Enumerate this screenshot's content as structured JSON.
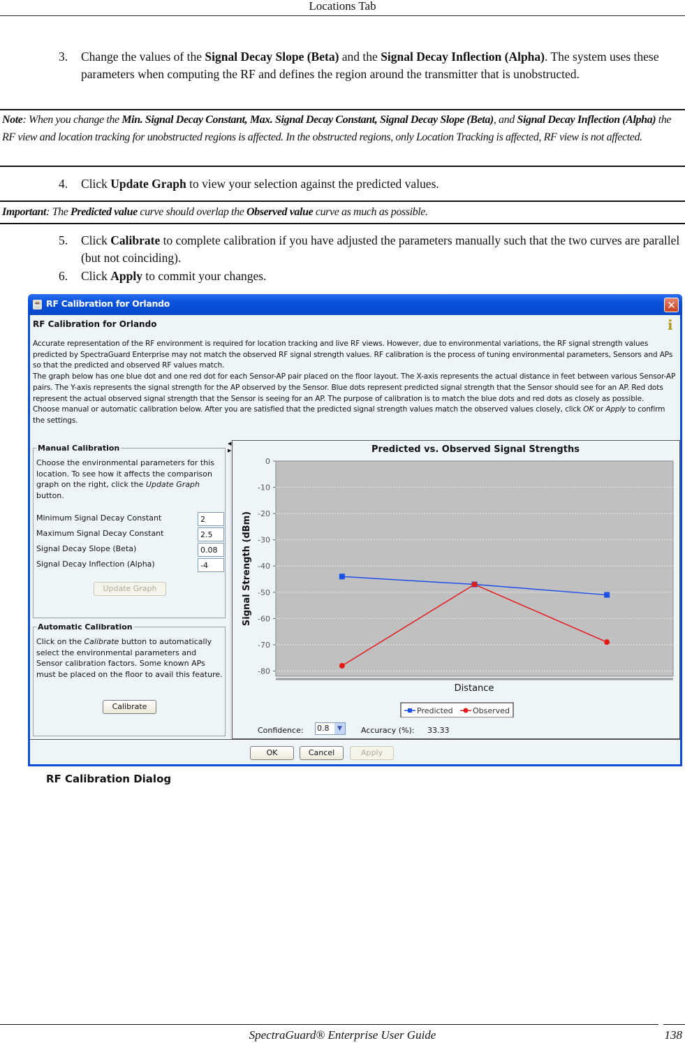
{
  "header": {
    "title": "Locations Tab"
  },
  "steps": [
    {
      "num": "3.",
      "parts": [
        {
          "t": "Change the values of the "
        },
        {
          "b": "Signal Decay Slope (Beta)"
        },
        {
          "t": " and the "
        },
        {
          "b": "Signal Decay Inflection (Alpha)"
        },
        {
          "t": ". The system uses these parameters when computing the RF and defines the region around the transmitter that is unobstructed."
        }
      ]
    },
    {
      "num": "4.",
      "parts": [
        {
          "t": "Click "
        },
        {
          "b": "Update Graph"
        },
        {
          "t": " to view your selection against the predicted values."
        }
      ]
    },
    {
      "num": "5.",
      "parts": [
        {
          "t": "Click "
        },
        {
          "b": "Calibrate"
        },
        {
          "t": " to complete calibration if you have adjusted the parameters manually such that the two curves are parallel (but not coinciding)."
        }
      ]
    },
    {
      "num": "6.",
      "parts": [
        {
          "t": "Click "
        },
        {
          "b": "Apply"
        },
        {
          "t": " to commit your changes."
        }
      ]
    }
  ],
  "note": {
    "parts": [
      {
        "b": "Note"
      },
      {
        "t": ": When you change the "
      },
      {
        "b": "Min. Signal Decay Constant, Max. Signal Decay Constant, Signal Decay Slope (Beta)"
      },
      {
        "t": ", and "
      },
      {
        "b": "Signal Decay Inflection (Alpha)"
      },
      {
        "t": " the RF view and location tracking for unobstructed regions is affected. In the obstructed regions, only Location Tracking is affected, RF view is not affected."
      }
    ]
  },
  "important": {
    "parts": [
      {
        "b": "Important"
      },
      {
        "t": ": The "
      },
      {
        "b": "Predicted value"
      },
      {
        "t": " curve should overlap the "
      },
      {
        "b": "Observed value"
      },
      {
        "t": " curve as much as possible."
      }
    ]
  },
  "dialog": {
    "window_title": "RF Calibration for Orlando",
    "heading": "RF Calibration for Orlando",
    "intro_paragraphs": [
      "Accurate representation of the RF environment is required for location tracking and live RF views. However, due to environmental variations, the RF signal strength values predicted by SpectraGuard Enterprise may not match the observed RF signal strength values. RF calibration is the process of tuning environmental parameters, Sensors and APs so that the predicted and observed RF values match.",
      "The graph below has one blue dot and one red dot for each Sensor-AP pair placed on the floor layout. The X-axis represents the actual distance in feet between various Sensor-AP pairs. The Y-axis represents the signal strength for the AP observed by the Sensor. Blue dots represent predicted signal strength that the Sensor should see for an AP. Red dots represent the actual observed signal strength that the Sensor is seeing for an AP. The purpose of calibration is to match the blue dots and red dots as closely as possible."
    ],
    "intro_last": {
      "before": "Choose manual or automatic calibration below. After you are satisfied that the predicted signal strength values match the observed values closely, click ",
      "ok": "OK",
      "or": " or ",
      "apply": "Apply",
      "after": " to confirm the settings."
    },
    "manual": {
      "legend": "Manual Calibration",
      "desc_before": "Choose the environmental parameters for this location. To see how it affects the comparison graph on the right, click the ",
      "desc_em": "Update Graph",
      "desc_after": " button.",
      "params": [
        {
          "label": "Minimum Signal Decay Constant",
          "value": "2"
        },
        {
          "label": "Maximum Signal Decay Constant",
          "value": "2.5"
        },
        {
          "label": "Signal Decay Slope (Beta)",
          "value": "0.08"
        },
        {
          "label": "Signal Decay Inflection (Alpha)",
          "value": "-4"
        }
      ],
      "update_button": "Update Graph"
    },
    "automatic": {
      "legend": "Automatic Calibration",
      "desc_before": "Click on the ",
      "desc_em": "Calibrate",
      "desc_after": " button to automatically select the environmental parameters and Sensor calibration factors. Some known APs must be placed on the floor to avail this feature.",
      "calibrate_button": "Calibrate"
    },
    "confidence_label": "Confidence:",
    "confidence_value": "0.8",
    "accuracy_label": "Accuracy (%):",
    "accuracy_value": "33.33",
    "buttons": {
      "ok": "OK",
      "cancel": "Cancel",
      "apply": "Apply"
    }
  },
  "chart_data": {
    "type": "line",
    "title": "Predicted vs. Observed Signal Strengths",
    "xlabel": "Distance",
    "ylabel": "Signal Strength (dBm)",
    "x": [
      1,
      2,
      3
    ],
    "ylim": [
      -82,
      0
    ],
    "yticks": [
      0,
      -10,
      -20,
      -30,
      -40,
      -50,
      -60,
      -70,
      -80
    ],
    "grid": true,
    "legend": "bottom-center",
    "series": [
      {
        "name": "Predicted",
        "color": "#1a4fe8",
        "marker": "square",
        "values": [
          -44,
          -47,
          -51
        ]
      },
      {
        "name": "Observed",
        "color": "#e31a1a",
        "marker": "circle",
        "values": [
          -78,
          -47,
          -69
        ]
      }
    ]
  },
  "caption": "RF Calibration Dialog",
  "footer": {
    "title": "SpectraGuard® Enterprise User Guide",
    "page": "138"
  }
}
